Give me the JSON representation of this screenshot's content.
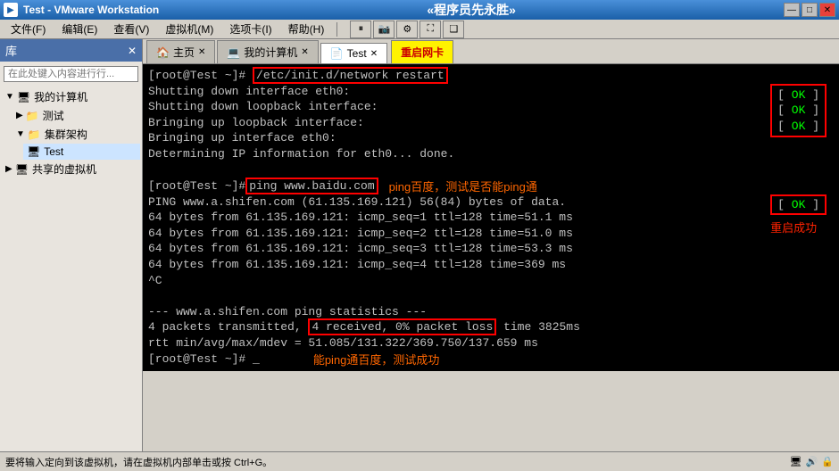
{
  "titlebar": {
    "title": "Test - VMware Workstation",
    "center_text": "«程序员先永胜»",
    "min": "—",
    "max": "□",
    "close": "✕"
  },
  "menubar": {
    "items": [
      "文件(F)",
      "编辑(E)",
      "查看(V)",
      "虚拟机(M)",
      "选项卡(I)",
      "帮助(H)"
    ]
  },
  "tabs": [
    {
      "label": "主页",
      "icon": "🏠",
      "closable": true
    },
    {
      "label": "我的计算机",
      "icon": "💻",
      "closable": true
    },
    {
      "label": "Test",
      "icon": "📄",
      "closable": true
    }
  ],
  "tab_restart": "重启网卡",
  "sidebar": {
    "header": "库",
    "search_placeholder": "在此处键入内容进行行...",
    "tree": [
      {
        "label": "我的计算机",
        "level": 1,
        "expanded": true,
        "icon": "💻"
      },
      {
        "label": "测试",
        "level": 2,
        "icon": "📁"
      },
      {
        "label": "集群架构",
        "level": 2,
        "expanded": true,
        "icon": "📁"
      },
      {
        "label": "Test",
        "level": 3,
        "icon": "💻",
        "selected": true
      },
      {
        "label": "共享的虚拟机",
        "level": 1,
        "icon": "🖥"
      }
    ]
  },
  "terminal": {
    "lines": [
      {
        "type": "cmd",
        "prompt": "[root@Test ~]#",
        "cmd": " /etc/init.d/network restart",
        "highlight": true
      },
      {
        "type": "plain",
        "text": "Shutting down interface eth0:"
      },
      {
        "type": "plain",
        "text": "Shutting down loopback interface:"
      },
      {
        "type": "plain",
        "text": "Bringing up loopback interface:"
      },
      {
        "type": "plain",
        "text": "Bringing up interface eth0:"
      },
      {
        "type": "plain",
        "text": "Determining IP information for eth0... done."
      },
      {
        "type": "blank"
      },
      {
        "type": "cmd",
        "prompt": "[root@Test ~]#",
        "cmd": " ping www.baidu.com",
        "highlight": true
      },
      {
        "type": "plain",
        "text": "PING www.a.shifen.com (61.135.169.121) 56(84) bytes of data."
      },
      {
        "type": "plain",
        "text": "64 bytes from 61.135.169.121: icmp_seq=1 ttl=128 time=51.1 ms"
      },
      {
        "type": "plain",
        "text": "64 bytes from 61.135.169.121: icmp_seq=2 ttl=128 time=51.0 ms"
      },
      {
        "type": "plain",
        "text": "64 bytes from 61.135.169.121: icmp_seq=3 ttl=128 time=53.3 ms"
      },
      {
        "type": "plain",
        "text": "64 bytes from 61.135.169.121: icmp_seq=4 ttl=128 time=369 ms"
      },
      {
        "type": "plain",
        "text": "^C"
      },
      {
        "type": "blank"
      },
      {
        "type": "plain",
        "text": "--- www.a.shifen.com ping statistics ---"
      },
      {
        "type": "stat",
        "before": "4 packets transmitted, ",
        "highlight": "4 received, 0% packet loss",
        "after": " time 3825ms"
      },
      {
        "type": "plain",
        "text": "rtt min/avg/max/mdev = 51.085/131.322/369.750/137.659 ms"
      },
      {
        "type": "cmd",
        "prompt": "[root@Test ~]#",
        "cmd": " _",
        "highlight": false
      }
    ],
    "ok_labels": [
      "OK",
      "OK",
      "OK",
      "OK"
    ],
    "annotations": {
      "ping_annotation": "ping百度，测试是否能ping通",
      "restart_success": "重启成功",
      "ping_success": "能ping通百度，测试成功"
    }
  },
  "statusbar": {
    "text": "要将输入定向到该虚拟机，请在虚拟机内部单击或按 Ctrl+G。"
  }
}
